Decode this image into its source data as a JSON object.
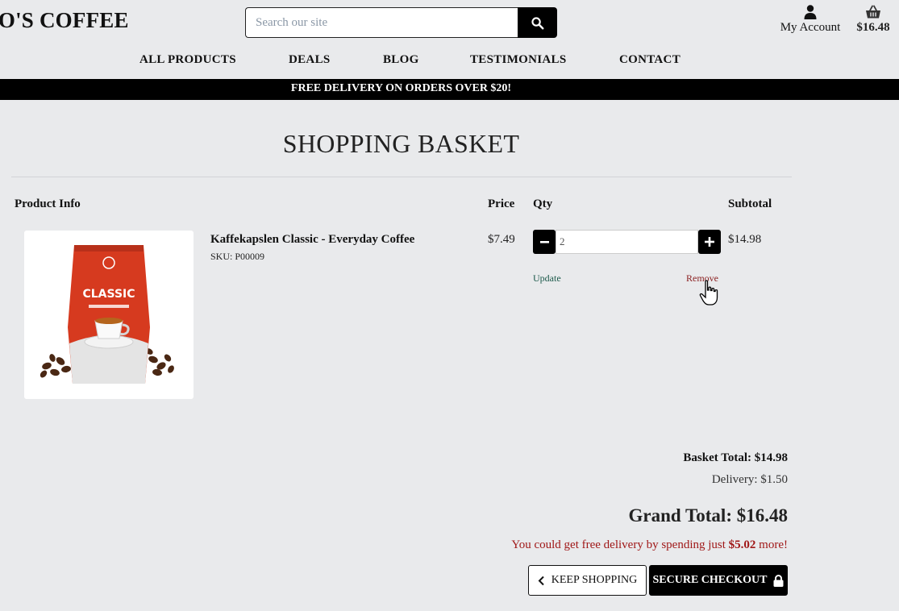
{
  "header": {
    "logo_text": "GIO'S COFFEE",
    "search_placeholder": "Search our site",
    "account_label": "My Account",
    "basket_amount": "$16.48"
  },
  "nav": {
    "items": [
      "ALL PRODUCTS",
      "DEALS",
      "BLOG",
      "TESTIMONIALS",
      "CONTACT"
    ]
  },
  "banner": "FREE DELIVERY ON ORDERS OVER $20!",
  "page_title": "SHOPPING BASKET",
  "table": {
    "headers": {
      "product": "Product Info",
      "price": "Price",
      "qty": "Qty",
      "subtotal": "Subtotal"
    },
    "rows": [
      {
        "name": "Kaffekapslen Classic - Everyday Coffee",
        "sku": "SKU: P00009",
        "price": "$7.49",
        "qty": "2",
        "subtotal": "$14.98",
        "update_label": "Update",
        "remove_label": "Remove",
        "image_label": "CLASSIC"
      }
    ]
  },
  "summary": {
    "basket_total": "Basket Total: $14.98",
    "delivery": "Delivery: $1.50",
    "grand_total": "Grand Total: $16.48",
    "free_msg_prefix": "You could get free delivery by spending just ",
    "free_msg_amount": "$5.02",
    "free_msg_suffix": " more!"
  },
  "buttons": {
    "keep_shopping": "KEEP SHOPPING",
    "secure_checkout": "SECURE CHECKOUT"
  },
  "colors": {
    "background": "#e9eaec",
    "black": "#000000",
    "remove": "#8a1f1f",
    "update": "#1d5a4b",
    "free_msg": "#a01818",
    "bag_red": "#d63a1f"
  }
}
